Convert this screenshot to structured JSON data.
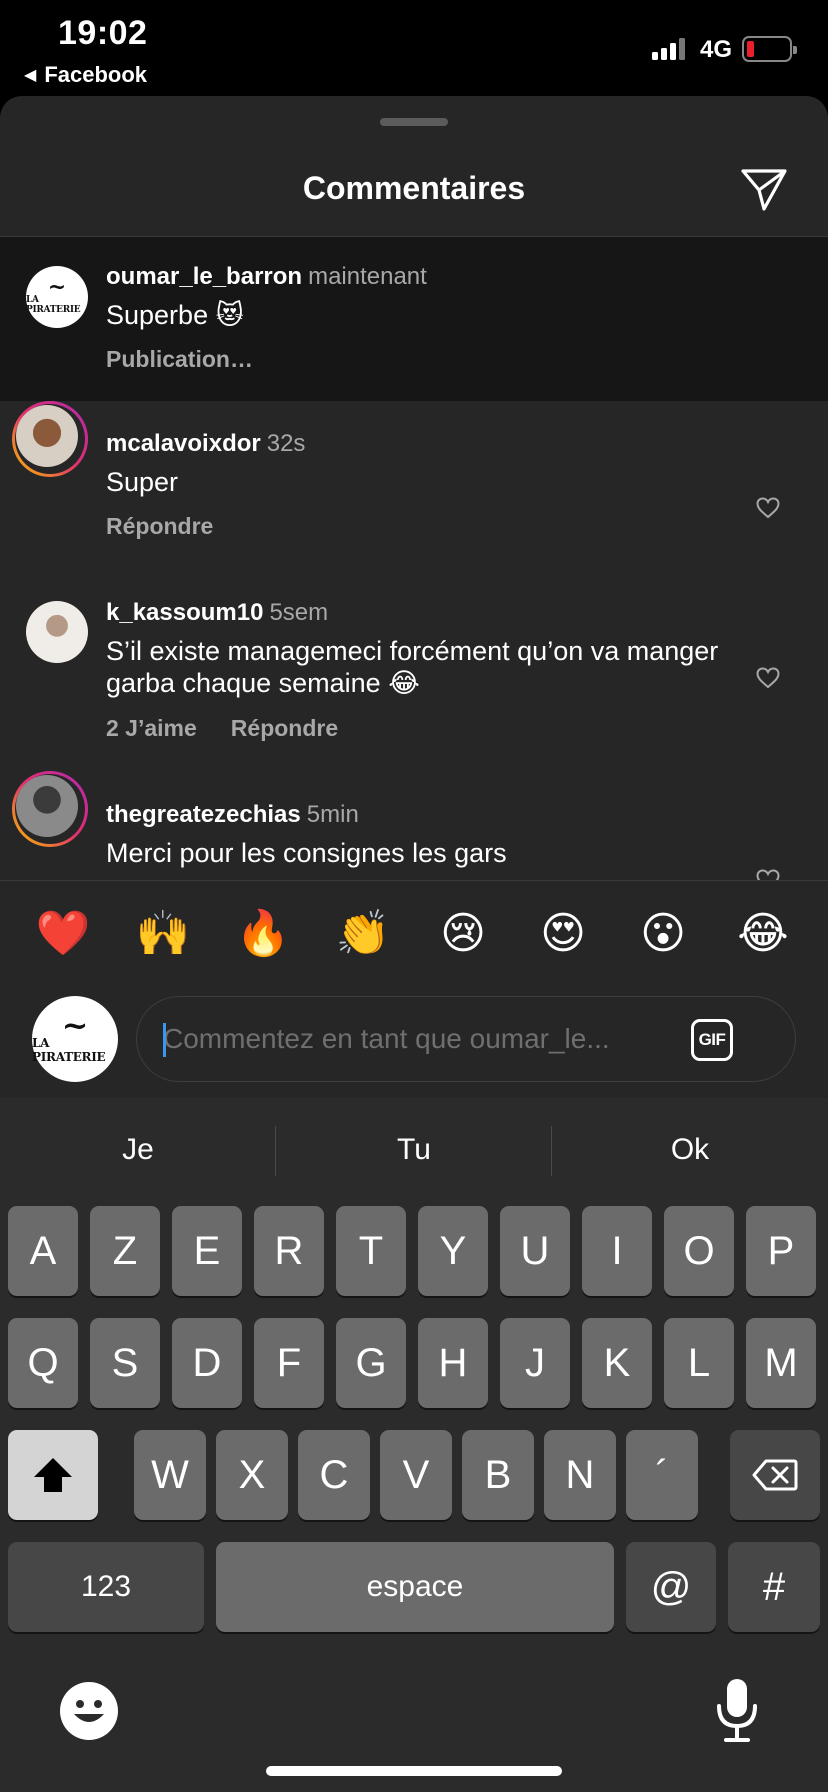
{
  "status_bar": {
    "time": "19:02",
    "back_app": "Facebook",
    "network": "4G",
    "battery_level": 0.12
  },
  "sheet": {
    "title": "Commentaires",
    "send_icon": "paper-plane-icon"
  },
  "comments": [
    {
      "username": "oumar_le_barron",
      "time": "maintenant",
      "text": "Superbe 😻",
      "meta": [
        "Publication…"
      ]
    },
    {
      "username": "mcalavoixdor",
      "time": "32s",
      "text": "Super",
      "meta": [
        "Répondre"
      ]
    },
    {
      "username": "k_kassoum10",
      "time": "5sem",
      "text": "S’il existe managemeci forcément qu’on va manger garba chaque semaine 😂",
      "meta": [
        "2 J’aime",
        "Répondre"
      ]
    },
    {
      "username": "thegreatezechias",
      "time": "5min",
      "text": "Merci pour les consignes les gars",
      "meta": []
    }
  ],
  "avatar_logo": {
    "line1": "~",
    "line2": "LA PIRATERIE"
  },
  "emoji_bar": [
    "❤️",
    "🙌",
    "🔥",
    "👏",
    "😢",
    "😍",
    "😮",
    "😂"
  ],
  "input": {
    "placeholder": "Commentez en tant que oumar_le...",
    "gif_label": "GIF"
  },
  "keyboard": {
    "suggestions": [
      "Je",
      "Tu",
      "Ok"
    ],
    "row1": [
      "A",
      "Z",
      "E",
      "R",
      "T",
      "Y",
      "U",
      "I",
      "O",
      "P"
    ],
    "row2": [
      "Q",
      "S",
      "D",
      "F",
      "G",
      "H",
      "J",
      "K",
      "L",
      "M"
    ],
    "row3": [
      "W",
      "X",
      "C",
      "V",
      "B",
      "N",
      "´"
    ],
    "numbers_key": "123",
    "space_key": "espace",
    "at_key": "@",
    "hash_key": "#"
  }
}
